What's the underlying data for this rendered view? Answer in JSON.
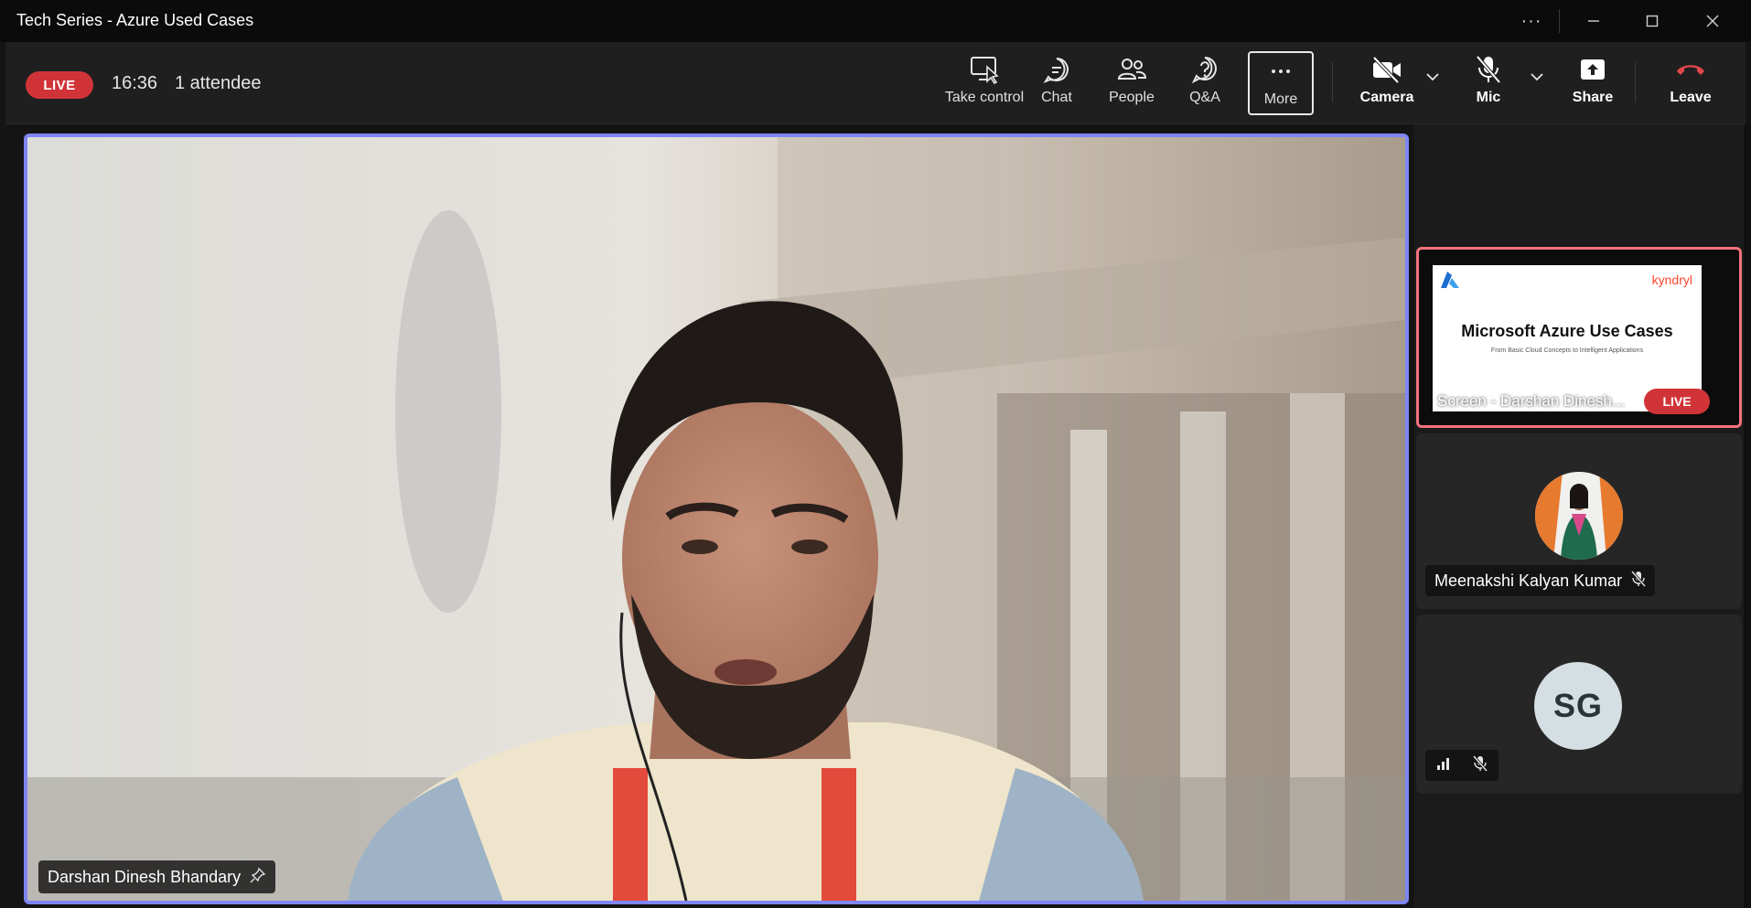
{
  "window": {
    "title": "Tech Series - Azure Used Cases",
    "more_icon": "ellipsis-icon",
    "minimize_icon": "minimize-icon",
    "maximize_icon": "maximize-icon",
    "close_icon": "close-icon"
  },
  "meeting": {
    "live_label": "LIVE",
    "elapsed": "16:36",
    "attendees": "1 attendee"
  },
  "toolbar": {
    "take_control": "Take control",
    "chat": "Chat",
    "people": "People",
    "qa": "Q&A",
    "more": "More",
    "camera": "Camera",
    "mic": "Mic",
    "share": "Share",
    "leave": "Leave"
  },
  "colors": {
    "live_red": "#d13438",
    "active_speaker_border": "#7f85f5",
    "screen_tile_border": "#f2737b",
    "leave_red": "#e0474c"
  },
  "main_video": {
    "participant_name": "Darshan Dinesh Bhandary",
    "pin_icon": "pin-icon"
  },
  "side_panel": {
    "screen_tile": {
      "label": "Screen - Darshan Dinesh...",
      "live_label": "LIVE",
      "slide_title": "Microsoft Azure Use Cases",
      "slide_subtitle": "From Basic Cloud Concepts to Intelligent Applications",
      "slide_brand": "kyndryl"
    },
    "participants": [
      {
        "name": "Meenakshi Kalyan Kumar",
        "muted": true
      },
      {
        "initials": "SG",
        "muted": true
      }
    ]
  }
}
